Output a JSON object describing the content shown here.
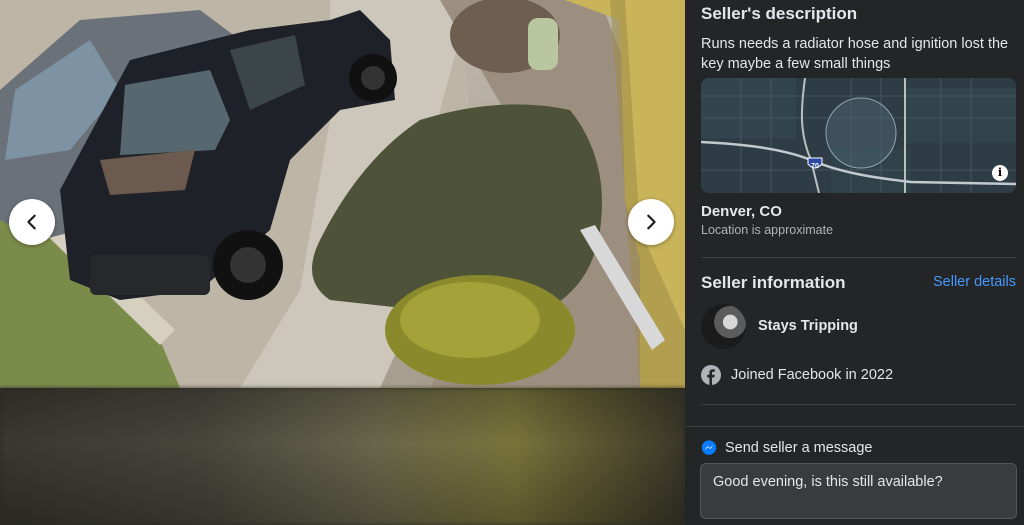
{
  "viewer": {
    "prev_icon": "chevron-left-icon",
    "next_icon": "chevron-right-icon"
  },
  "description": {
    "title": "Seller's description",
    "text": "Runs needs a radiator hose and ignition lost the key maybe a few small things"
  },
  "map": {
    "highway_label": "70",
    "info_icon": "info-icon",
    "info_glyph": "i"
  },
  "location": {
    "city": "Denver, CO",
    "note": "Location is approximate"
  },
  "seller": {
    "section_title": "Seller information",
    "details_link": "Seller details",
    "name": "Stays Tripping",
    "joined": "Joined Facebook in 2022"
  },
  "message": {
    "label": "Send seller a message",
    "value": "Good evening, is this still available?"
  },
  "colors": {
    "panel_bg": "#242526",
    "accent_link": "#4599ff",
    "messenger": "#0a7cff",
    "text_primary": "#e4e6eb",
    "text_secondary": "#b0b3b8"
  }
}
